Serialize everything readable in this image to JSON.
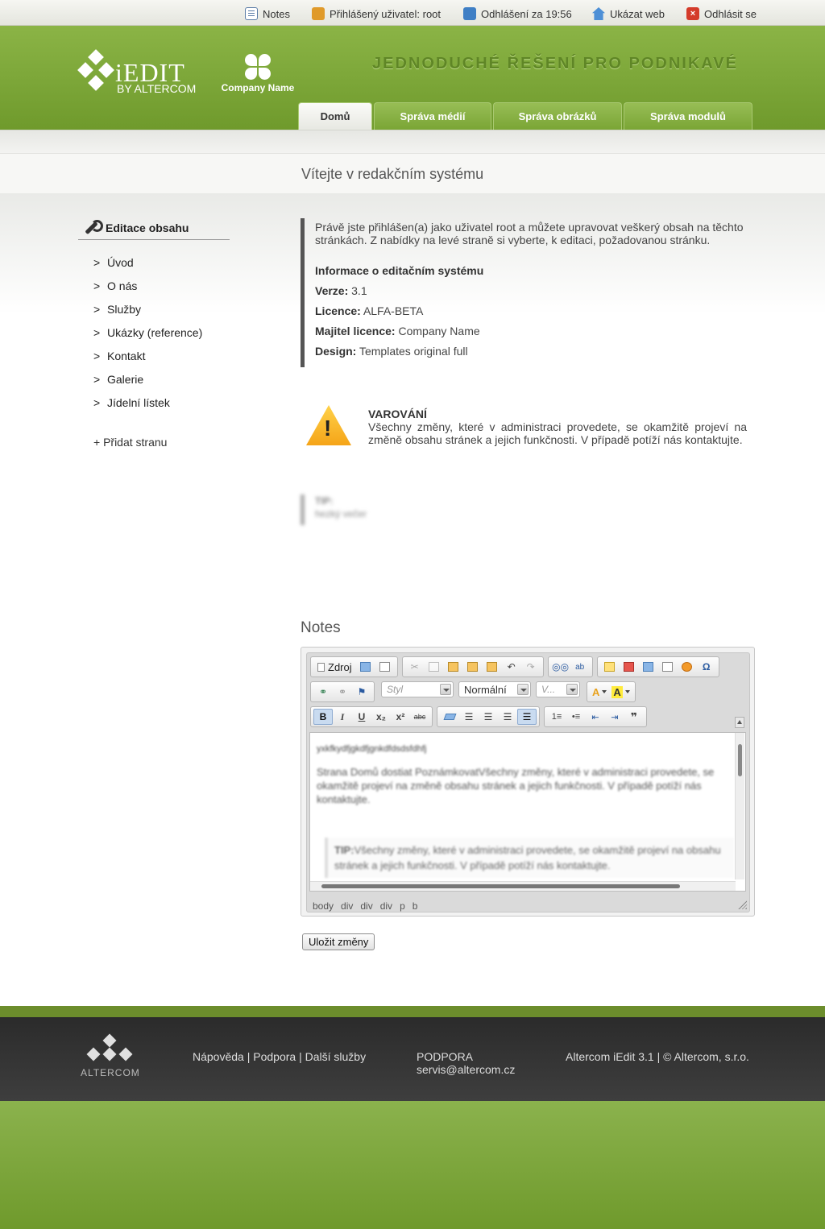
{
  "topbar": {
    "notes": "Notes",
    "user": "Přihlášený uživatel: root",
    "logout_timer": "Odhlášení za 19:56",
    "show_web": "Ukázat web",
    "logout": "Odhlásit se"
  },
  "header": {
    "logo_text": "iEDIT",
    "logo_sub": "BY ALTERCOM",
    "company": "Company Name",
    "slogan": "JEDNODUCHÉ ŘEŠENÍ PRO PODNIKAVÉ",
    "tabs": [
      {
        "label": "Domů",
        "active": true
      },
      {
        "label": "Správa médií",
        "active": false
      },
      {
        "label": "Správa obrázků",
        "active": false
      },
      {
        "label": "Správa modulů",
        "active": false
      }
    ]
  },
  "page_title": "Vítejte v redakčním systému",
  "sidebar": {
    "title": "Editace obsahu",
    "items": [
      {
        "arrow": ">",
        "label": "Úvod"
      },
      {
        "arrow": ">",
        "label": "O nás"
      },
      {
        "arrow": ">",
        "label": "Služby"
      },
      {
        "arrow": ">",
        "label": "Ukázky (reference)"
      },
      {
        "arrow": ">",
        "label": "Kontakt"
      },
      {
        "arrow": ">",
        "label": "Galerie"
      },
      {
        "arrow": ">",
        "label": "Jídelní lístek"
      }
    ],
    "add_page": "+ Přidat stranu"
  },
  "info": {
    "intro": "Právě jste přihlášen(a) jako uživatel root a můžete upravovat veškerý obsah na těchto stránkách. Z nabídky na levé straně si vyberte, k editaci, požadovanou stránku.",
    "heading": "Informace o editačním systému",
    "rows": [
      {
        "label": "Verze:",
        "value": "3.1"
      },
      {
        "label": "Licence:",
        "value": "ALFA-BETA"
      },
      {
        "label": "Majitel licence:",
        "value": "Company Name"
      },
      {
        "label": "Design:",
        "value": "Templates original full"
      }
    ]
  },
  "warning": {
    "title": "VAROVÁNÍ",
    "text": "Všechny změny, které v administraci provedete, se okamžitě projeví na změně obsahu stránek a jejich funkčnosti. V případě potíží nás kontaktujte."
  },
  "tip": {
    "label": "TIP:",
    "text": "hezký večer"
  },
  "notes": {
    "title": "Notes",
    "toolbar": {
      "source_label": "Zdroj",
      "style_placeholder": "Styl",
      "format_value": "Normální",
      "size_placeholder": "V..."
    },
    "content": {
      "line1": "yxkfkydfjgkdfjgnkdfdsdsfdhfj",
      "line2": "Strana Domů dostiat PoznámkovatVšechny změny, které v administraci provedete, se okamžitě projeví na změně obsahu stránek a jejich funkčnosti. V případě potíží nás kontaktujte.",
      "tip_label": "TIP:",
      "tip_text": "Všechny změny, které v administraci provedete, se okamžitě projeví na obsahu stránek a jejich funkčnosti. V případě potíží nás kontaktujte."
    },
    "path": [
      "body",
      "div",
      "div",
      "div",
      "p",
      "b"
    ],
    "save_label": "Uložit změny"
  },
  "footer": {
    "logo_text": "ALTERCOM",
    "links": [
      "Nápověda",
      "Podpora",
      "Další služby"
    ],
    "support_title": "PODPORA",
    "support_email": "servis@altercom.cz",
    "copyright": "Altercom iEdit 3.1 | © Altercom, s.r.o."
  },
  "colors": {
    "brand_green": "#7aa535",
    "footer_dark": "#2b2b2b"
  }
}
